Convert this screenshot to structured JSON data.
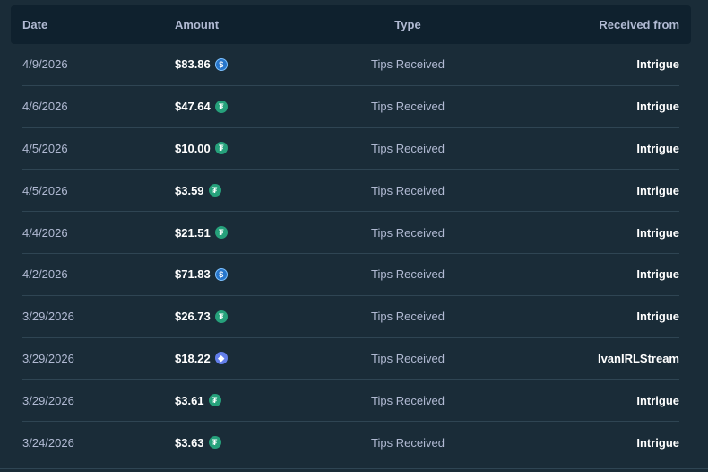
{
  "header": {
    "date": "Date",
    "amount": "Amount",
    "type": "Type",
    "received_from": "Received from"
  },
  "rows": [
    {
      "date": "4/9/2026",
      "amount": "$83.86",
      "coin": "usdc",
      "coin_glyph": "$",
      "type": "Tips Received",
      "from": "Intrigue"
    },
    {
      "date": "4/6/2026",
      "amount": "$47.64",
      "coin": "usdt",
      "coin_glyph": "₮",
      "type": "Tips Received",
      "from": "Intrigue"
    },
    {
      "date": "4/5/2026",
      "amount": "$10.00",
      "coin": "usdt",
      "coin_glyph": "₮",
      "type": "Tips Received",
      "from": "Intrigue"
    },
    {
      "date": "4/5/2026",
      "amount": "$3.59",
      "coin": "usdt",
      "coin_glyph": "₮",
      "type": "Tips Received",
      "from": "Intrigue"
    },
    {
      "date": "4/4/2026",
      "amount": "$21.51",
      "coin": "usdt",
      "coin_glyph": "₮",
      "type": "Tips Received",
      "from": "Intrigue"
    },
    {
      "date": "4/2/2026",
      "amount": "$71.83",
      "coin": "usdc",
      "coin_glyph": "$",
      "type": "Tips Received",
      "from": "Intrigue"
    },
    {
      "date": "3/29/2026",
      "amount": "$26.73",
      "coin": "usdt",
      "coin_glyph": "₮",
      "type": "Tips Received",
      "from": "Intrigue"
    },
    {
      "date": "3/29/2026",
      "amount": "$18.22",
      "coin": "eth",
      "coin_glyph": "◆",
      "type": "Tips Received",
      "from": "IvanIRLStream"
    },
    {
      "date": "3/29/2026",
      "amount": "$3.61",
      "coin": "usdt",
      "coin_glyph": "₮",
      "type": "Tips Received",
      "from": "Intrigue"
    },
    {
      "date": "3/24/2026",
      "amount": "$3.63",
      "coin": "usdt",
      "coin_glyph": "₮",
      "type": "Tips Received",
      "from": "Intrigue"
    }
  ],
  "colors": {
    "background": "#1a2c38",
    "header_bg": "#0f212e",
    "muted_text": "#b1bad3",
    "usdt": "#26a17b",
    "usdc": "#2775ca",
    "eth": "#627eea"
  }
}
